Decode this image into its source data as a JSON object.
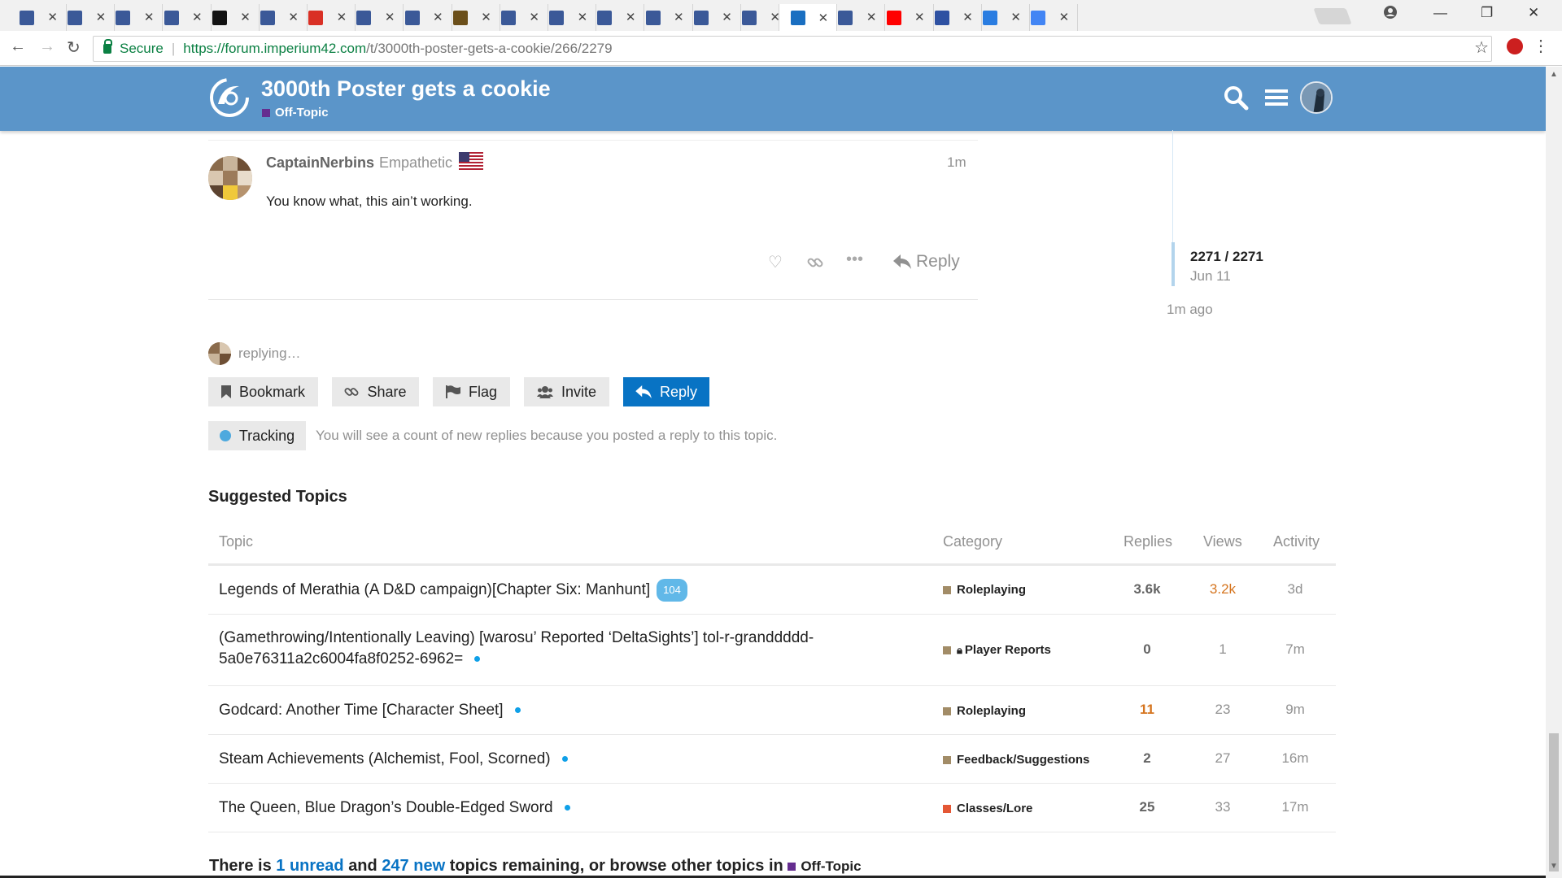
{
  "browser": {
    "tabs": [
      {
        "icon": "forum-favicon",
        "color": "#3b5998"
      },
      {
        "icon": "forum-favicon",
        "color": "#3b5998"
      },
      {
        "icon": "forum-favicon",
        "color": "#3b5998"
      },
      {
        "icon": "forum-favicon",
        "color": "#3b5998"
      },
      {
        "icon": "io-favicon",
        "color": "#111111"
      },
      {
        "icon": "forum-favicon",
        "color": "#3b5998"
      },
      {
        "icon": "gmail-favicon",
        "color": "#d93025"
      },
      {
        "icon": "forum-favicon",
        "color": "#3b5998"
      },
      {
        "icon": "forum-favicon",
        "color": "#3b5998"
      },
      {
        "icon": "image-favicon",
        "color": "#6b4f1a"
      },
      {
        "icon": "forum-favicon",
        "color": "#3b5998"
      },
      {
        "icon": "forum-favicon",
        "color": "#3b5998"
      },
      {
        "icon": "forum-favicon",
        "color": "#3b5998"
      },
      {
        "icon": "forum-favicon",
        "color": "#3b5998"
      },
      {
        "icon": "forum-favicon",
        "color": "#3b5998"
      },
      {
        "icon": "forum-favicon",
        "color": "#3b5998"
      },
      {
        "icon": "imperium-favicon",
        "color": "#1a6fc1",
        "active": true
      },
      {
        "icon": "forum-favicon",
        "color": "#3b5998"
      },
      {
        "icon": "youtube-favicon",
        "color": "#ff0000"
      },
      {
        "icon": "mal-favicon",
        "color": "#2e51a2"
      },
      {
        "icon": "paw-favicon",
        "color": "#2a7de1"
      },
      {
        "icon": "google-favicon",
        "color": "#4285f4"
      }
    ],
    "tab_close": "✕",
    "secure_label": "Secure",
    "url_host": "https://forum.imperium42.com",
    "url_path": "/t/3000th-poster-gets-a-cookie/266/2279"
  },
  "header": {
    "title": "3000th Poster gets a cookie",
    "category": "Off-Topic",
    "category_color": "#652d90"
  },
  "post": {
    "username": "CaptainNerbins",
    "user_title": "Empathetic",
    "age": "1m",
    "body": "You know what, this ain’t working.",
    "reply_label": "Reply"
  },
  "timeline": {
    "position": "2271 / 2271",
    "date": "Jun 11",
    "ago": "1m ago"
  },
  "composer": {
    "replying": "replying",
    "buttons": {
      "bookmark": "Bookmark",
      "share": "Share",
      "flag": "Flag",
      "invite": "Invite",
      "reply": "Reply"
    },
    "tracking_label": "Tracking",
    "tracking_desc": "You will see a count of new replies because you posted a reply to this topic."
  },
  "suggested": {
    "heading": "Suggested Topics",
    "columns": {
      "topic": "Topic",
      "category": "Category",
      "replies": "Replies",
      "views": "Views",
      "activity": "Activity"
    },
    "rows": [
      {
        "title": "Legends of Merathia (A D&D campaign)[Chapter Six: Manhunt]",
        "badge": "104",
        "category": "Roleplaying",
        "cat_color": "#a28c67",
        "replies": "3.6k",
        "views": "3.2k",
        "activity": "3d"
      },
      {
        "title_line1": "(Gamethrowing/Intentionally Leaving) [warosu’ Reported ‘DeltaSights’] tol-r-granddddd-",
        "title_line2": "5a0e76311a2c6004fa8f0252-6962=",
        "category": "Player Reports",
        "cat_color": "#a28c67",
        "replies": "0",
        "views": "1",
        "activity": "7m"
      },
      {
        "title": "Godcard: Another Time [Character Sheet]",
        "category": "Roleplaying",
        "cat_color": "#a28c67",
        "replies": "11",
        "views": "23",
        "activity": "9m"
      },
      {
        "title": "Steam Achievements (Alchemist, Fool, Scorned)",
        "category": "Feedback/Suggestions",
        "cat_color": "#a28c67",
        "replies": "2",
        "views": "27",
        "activity": "16m"
      },
      {
        "title": "The Queen, Blue Dragon’s Double-Edged Sword",
        "category": "Classes/Lore",
        "cat_color": "#e45735",
        "replies": "25",
        "views": "33",
        "activity": "17m"
      }
    ]
  },
  "footer": {
    "prefix": "There is",
    "unread": "1 unread",
    "and": "and",
    "new": "247 new",
    "suffix": "topics remaining, or browse other topics in",
    "category": "Off-Topic"
  }
}
